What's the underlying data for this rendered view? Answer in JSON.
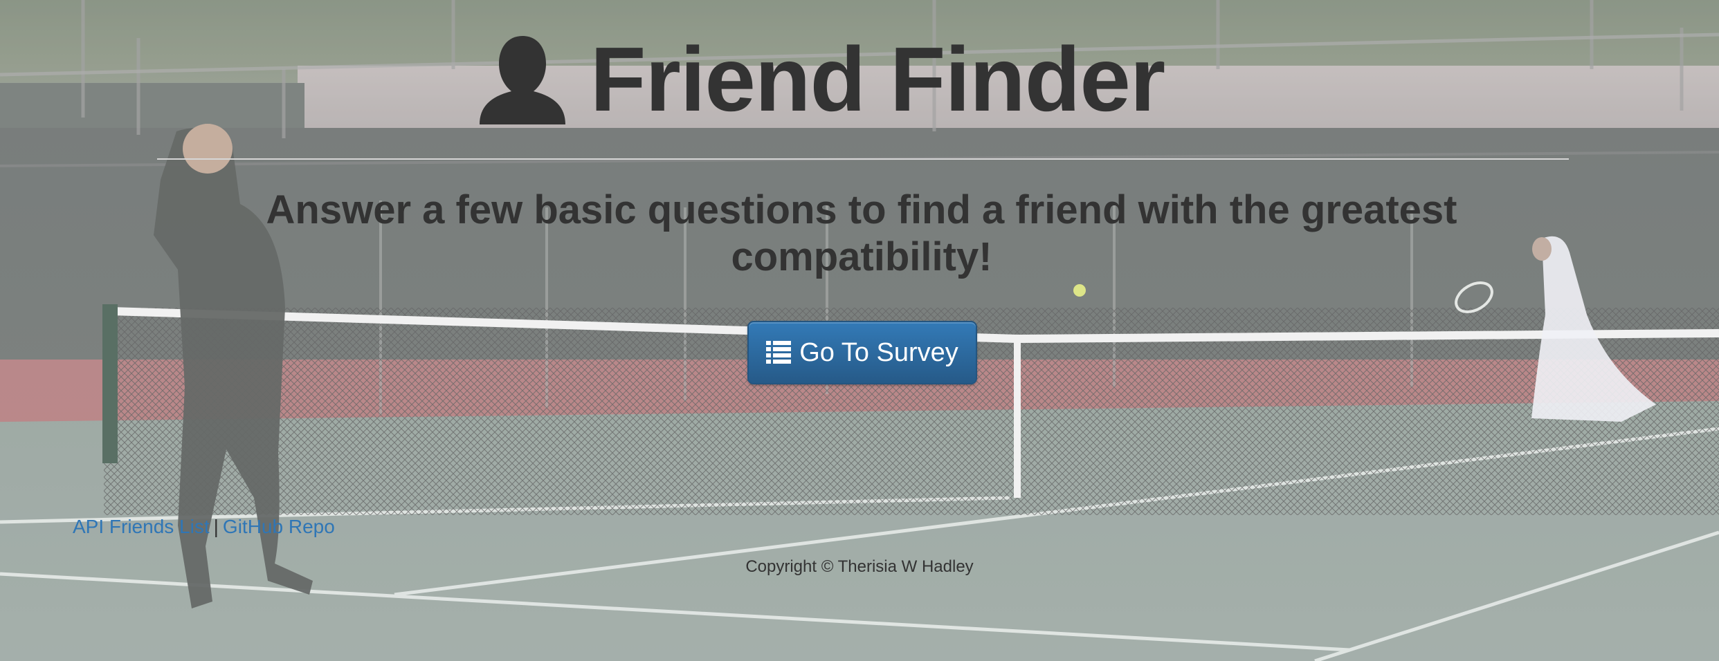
{
  "header": {
    "icon": "user-icon",
    "title": "Friend Finder"
  },
  "main": {
    "subtitle": "Answer a few basic questions to find a friend with the greatest compatibility!",
    "survey_button": {
      "icon": "list-icon",
      "label": "Go To Survey"
    }
  },
  "footer": {
    "links": [
      {
        "label": "API Friends List"
      },
      {
        "label": "GitHub Repo"
      }
    ],
    "separator": "|",
    "copyright": "Copyright © Therisia W Hadley"
  },
  "colors": {
    "text": "#333333",
    "button": "#337ab7",
    "link": "#2f76b6"
  }
}
